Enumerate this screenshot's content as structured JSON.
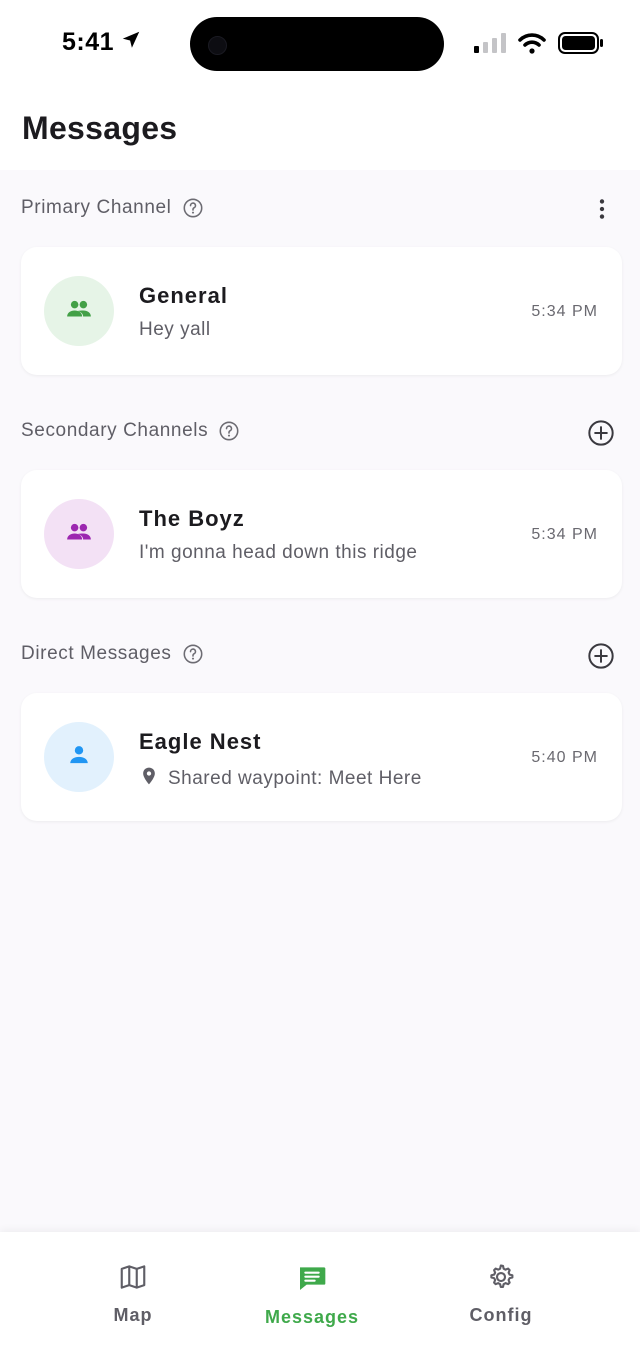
{
  "status_bar": {
    "time": "5:41",
    "icons": [
      "location-arrow-icon",
      "signal-icon",
      "wifi-icon",
      "battery-icon"
    ]
  },
  "header": {
    "title": "Messages"
  },
  "colors": {
    "accent": "#3fa94b",
    "general_avatar_bg": "#e6f4e7",
    "general_icon": "#43a047",
    "boyz_avatar_bg": "#f3e1f5",
    "boyz_icon": "#9c27b0",
    "eagle_avatar_bg": "#e2f1fd",
    "eagle_icon": "#2196f3"
  },
  "sections": {
    "primary": {
      "title": "Primary Channel",
      "action_icon": "more-vertical-icon",
      "items": [
        {
          "name": "General",
          "preview": "Hey yall",
          "time": "5:34 PM",
          "icon": "group-icon"
        }
      ]
    },
    "secondary": {
      "title": "Secondary Channels",
      "action_icon": "add-circle-icon",
      "items": [
        {
          "name": "The Boyz",
          "preview": "I'm gonna head down this ridge",
          "time": "5:34 PM",
          "icon": "group-icon"
        }
      ]
    },
    "direct": {
      "title": "Direct Messages",
      "action_icon": "add-circle-icon",
      "items": [
        {
          "name": "Eagle Nest",
          "preview": "Shared waypoint: Meet Here",
          "time": "5:40 PM",
          "icon": "person-icon",
          "preview_icon": "location-pin-icon"
        }
      ]
    }
  },
  "nav": {
    "items": [
      {
        "label": "Map",
        "icon": "map-icon",
        "active": false
      },
      {
        "label": "Messages",
        "icon": "chat-icon",
        "active": true
      },
      {
        "label": "Config",
        "icon": "gear-icon",
        "active": false
      }
    ]
  }
}
